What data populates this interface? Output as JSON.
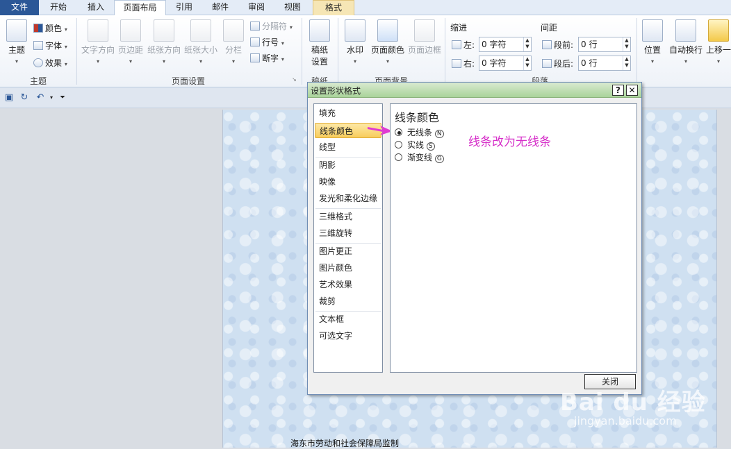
{
  "tabs": [
    "文件",
    "开始",
    "插入",
    "页面布局",
    "引用",
    "邮件",
    "审阅",
    "视图",
    "格式"
  ],
  "ribbon": {
    "theme_group": {
      "label": "主题",
      "big": "主题",
      "colors": "颜色",
      "fonts": "字体",
      "effects": "效果"
    },
    "page_setup": {
      "label": "页面设置",
      "text_direction": "文字方向",
      "margins": "页边距",
      "orientation": "纸张方向",
      "size": "纸张大小",
      "columns": "分栏",
      "breaks": "分隔符",
      "line_numbers": "行号",
      "hyphenation": "断字"
    },
    "manuscript": {
      "label": "稿纸",
      "button": "稿纸\n设置",
      "btn_line1": "稿纸",
      "btn_line2": "设置"
    },
    "page_background": {
      "label": "页面背景",
      "watermark": "水印",
      "page_color": "页面颜色",
      "page_borders": "页面边框"
    },
    "paragraph": {
      "label": "段落",
      "indent_title": "缩进",
      "spacing_title": "间距",
      "left_label": "左:",
      "left_value": "0 字符",
      "right_label": "右:",
      "right_value": "0 字符",
      "before_label": "段前:",
      "before_value": "0 行",
      "after_label": "段后:",
      "after_value": "0 行"
    },
    "arrange": {
      "position": "位置",
      "wrap_text": "自动换行",
      "bring_forward": "上移一"
    }
  },
  "dialog": {
    "title": "设置形状格式",
    "help": "?",
    "close_x": "✕",
    "categories": [
      "填充",
      "线条颜色",
      "线型",
      "阴影",
      "映像",
      "发光和柔化边缘",
      "三维格式",
      "三维旋转",
      "图片更正",
      "图片颜色",
      "艺术效果",
      "裁剪",
      "文本框",
      "可选文字"
    ],
    "selected_category": "线条颜色",
    "panel_title": "线条颜色",
    "options": [
      {
        "label": "无线条",
        "key": "N",
        "selected": true
      },
      {
        "label": "实线",
        "key": "S",
        "selected": false
      },
      {
        "label": "渐变线",
        "key": "G",
        "selected": false
      }
    ],
    "annotation": "线条改为无线条",
    "close_button": "关闭"
  },
  "document": {
    "footer_text": "海东市劳动和社会保障局监制"
  },
  "watermark": {
    "brand": "Bai du 经验",
    "url": "jingyan.baidu.com"
  },
  "colors": {
    "file_tab": "#2b5797",
    "annotation": "#d62fc9",
    "dialog_title": "#a9d39a",
    "selected_item": "#f8cd5c"
  }
}
